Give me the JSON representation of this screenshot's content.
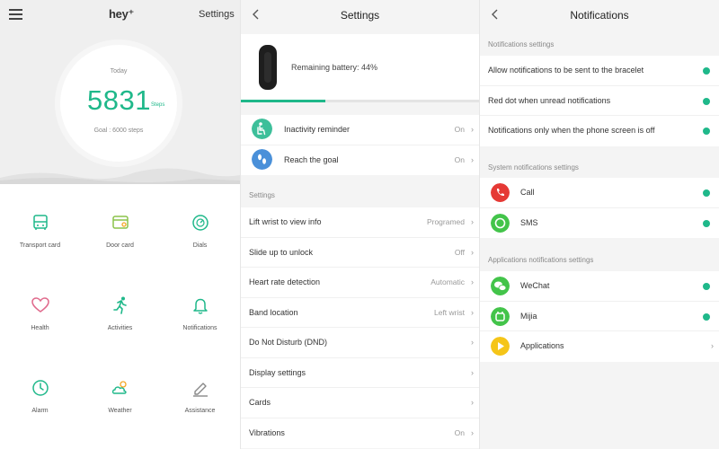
{
  "home": {
    "logo": "hey⁺",
    "settings_label": "Settings",
    "today_label": "Today",
    "steps": "5831",
    "steps_unit": "Steps",
    "goal_text": "Goal : 6000 steps",
    "tiles": [
      {
        "label": "Transport card",
        "icon": "bus-icon"
      },
      {
        "label": "Door card",
        "icon": "door-card-icon"
      },
      {
        "label": "Dials",
        "icon": "dial-icon"
      },
      {
        "label": "Health",
        "icon": "heart-icon"
      },
      {
        "label": "Activities",
        "icon": "running-icon"
      },
      {
        "label": "Notifications",
        "icon": "bell-icon"
      },
      {
        "label": "Alarm",
        "icon": "clock-icon"
      },
      {
        "label": "Weather",
        "icon": "weather-icon"
      },
      {
        "label": "Assistance",
        "icon": "pencil-icon"
      }
    ],
    "accent": "#1fb88a"
  },
  "settings": {
    "title": "Settings",
    "battery_text": "Remaining battery: 44%",
    "battery_percent": 44,
    "top_items": [
      {
        "label": "Inactivity reminder",
        "value": "On",
        "icon": "sitting-person-icon",
        "icon_color": "#3dbf9a"
      },
      {
        "label": "Reach the goal",
        "value": "On",
        "icon": "footprints-icon",
        "icon_color": "#4a90d9"
      }
    ],
    "section_label": "Settings",
    "items": [
      {
        "label": "Lift wrist to view info",
        "value": "Programed"
      },
      {
        "label": "Slide up to unlock",
        "value": "Off"
      },
      {
        "label": "Heart rate detection",
        "value": "Automatic"
      },
      {
        "label": "Band location",
        "value": "Left wrist"
      },
      {
        "label": "Do Not Disturb (DND)",
        "value": ""
      },
      {
        "label": "Display settings",
        "value": ""
      },
      {
        "label": "Cards",
        "value": ""
      },
      {
        "label": "Vibrations",
        "value": "On"
      }
    ]
  },
  "notifications": {
    "title": "Notifications",
    "section1_label": "Notifications settings",
    "section1_items": [
      {
        "label": "Allow notifications to be sent to the bracelet",
        "enabled": true
      },
      {
        "label": "Red dot when unread notifications",
        "enabled": true
      },
      {
        "label": "Notifications only when the phone screen is off",
        "enabled": true
      }
    ],
    "section2_label": "System notifications settings",
    "section2_items": [
      {
        "label": "Call",
        "icon": "phone-icon",
        "icon_color": "#e53935",
        "enabled": true
      },
      {
        "label": "SMS",
        "icon": "sms-icon",
        "icon_color": "#43c44a",
        "enabled": true
      }
    ],
    "section3_label": "Applications notifications settings",
    "section3_items": [
      {
        "label": "WeChat",
        "icon": "wechat-icon",
        "icon_color": "#43c44a",
        "enabled": true
      },
      {
        "label": "Mijia",
        "icon": "mijia-icon",
        "icon_color": "#43c44a",
        "enabled": true
      },
      {
        "label": "Applications",
        "icon": "apps-icon",
        "icon_color": "#f5c518",
        "has_chevron": true
      }
    ],
    "toggle_color": "#1fb88a"
  }
}
